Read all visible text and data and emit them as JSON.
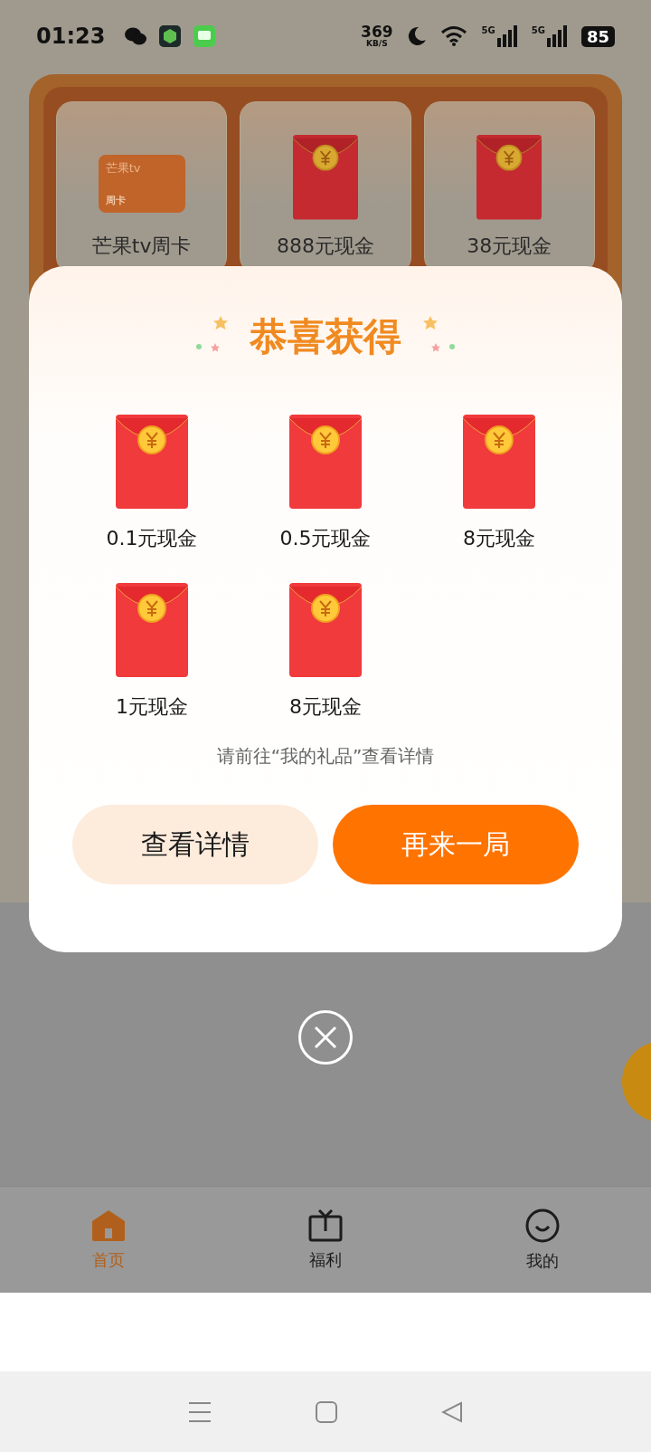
{
  "status_bar": {
    "time": "01:23",
    "net_speed": "369",
    "net_unit": "KB/S",
    "sim_labels": [
      "5G",
      "5G"
    ],
    "battery": "85"
  },
  "prize_panel": {
    "items": [
      {
        "kind": "card",
        "label": "芒果tv周卡",
        "card_brand": "芒果tv",
        "card_type": "周卡"
      },
      {
        "kind": "envelope",
        "label": "888元现金"
      },
      {
        "kind": "envelope",
        "label": "38元现金"
      }
    ]
  },
  "dialog": {
    "title": "恭喜获得",
    "prizes": [
      {
        "label": "0.1元现金"
      },
      {
        "label": "0.5元现金"
      },
      {
        "label": "8元现金"
      },
      {
        "label": "1元现金"
      },
      {
        "label": "8元现金"
      }
    ],
    "hint": "请前往“我的礼品”查看详情",
    "buttons": [
      {
        "label": "查看详情",
        "kind": "secondary"
      },
      {
        "label": "再来一局",
        "kind": "primary"
      }
    ]
  },
  "tab_bar": {
    "tabs": [
      {
        "label": "首页",
        "selected": true
      },
      {
        "label": "福利",
        "selected": false
      },
      {
        "label": "我的",
        "selected": false
      }
    ]
  }
}
